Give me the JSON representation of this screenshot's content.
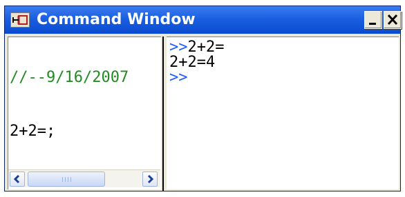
{
  "window": {
    "title": "Command Window",
    "icons": {
      "app": "pin-dock-icon",
      "minimize": "minimize-icon",
      "close": "close-icon"
    },
    "colors": {
      "titlebar": "#0a4ad0",
      "comment": "#228b22",
      "prompt": "#1e5bff"
    }
  },
  "history": {
    "comment": "//--9/16/2007",
    "command": "2+2=;"
  },
  "console": {
    "prompt": ">>",
    "lines": [
      {
        "prompt": ">>",
        "text": "2+2="
      },
      {
        "prompt": "",
        "text": "2+2=4"
      },
      {
        "prompt": ">>",
        "text": ""
      }
    ]
  },
  "scrollbar": {
    "icons": {
      "left": "arrow-left-icon",
      "right": "arrow-right-icon"
    }
  }
}
